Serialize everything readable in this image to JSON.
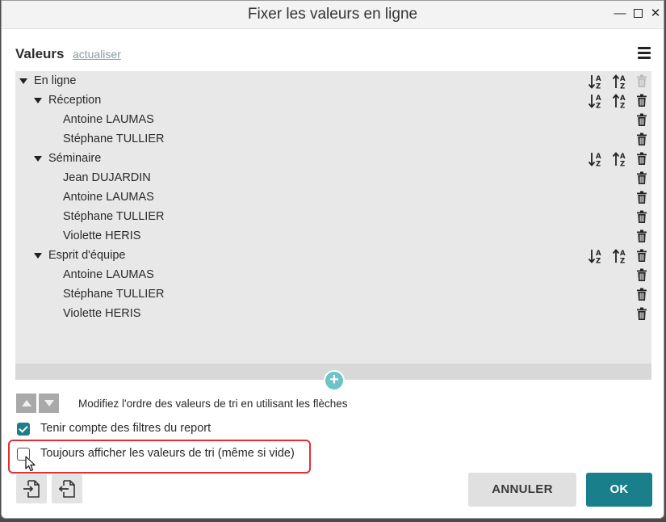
{
  "window": {
    "title": "Fixer les valeurs en ligne",
    "controls": [
      "minimize",
      "maximize",
      "close"
    ]
  },
  "header": {
    "label": "Valeurs",
    "refresh_link": "actualiser"
  },
  "tree": {
    "rows": [
      {
        "label": "En ligne",
        "level": 0,
        "expandable": true,
        "sort_buttons": true,
        "delete_enabled": false
      },
      {
        "label": "Réception",
        "level": 1,
        "expandable": true,
        "sort_buttons": true,
        "delete_enabled": true
      },
      {
        "label": "Antoine LAUMAS",
        "level": 2,
        "expandable": false,
        "sort_buttons": false,
        "delete_enabled": true
      },
      {
        "label": "Stéphane TULLIER",
        "level": 2,
        "expandable": false,
        "sort_buttons": false,
        "delete_enabled": true
      },
      {
        "label": "Séminaire",
        "level": 1,
        "expandable": true,
        "sort_buttons": true,
        "delete_enabled": true
      },
      {
        "label": "Jean DUJARDIN",
        "level": 2,
        "expandable": false,
        "sort_buttons": false,
        "delete_enabled": true
      },
      {
        "label": "Antoine LAUMAS",
        "level": 2,
        "expandable": false,
        "sort_buttons": false,
        "delete_enabled": true
      },
      {
        "label": "Stéphane TULLIER",
        "level": 2,
        "expandable": false,
        "sort_buttons": false,
        "delete_enabled": true
      },
      {
        "label": "Violette HERIS",
        "level": 2,
        "expandable": false,
        "sort_buttons": false,
        "delete_enabled": true
      },
      {
        "label": "Esprit d'équipe",
        "level": 1,
        "expandable": true,
        "sort_buttons": true,
        "delete_enabled": true
      },
      {
        "label": "Antoine LAUMAS",
        "level": 2,
        "expandable": false,
        "sort_buttons": false,
        "delete_enabled": true
      },
      {
        "label": "Stéphane TULLIER",
        "level": 2,
        "expandable": false,
        "sort_buttons": false,
        "delete_enabled": true
      },
      {
        "label": "Violette HERIS",
        "level": 2,
        "expandable": false,
        "sort_buttons": false,
        "delete_enabled": true
      }
    ]
  },
  "add_button_label": "+",
  "order": {
    "hint": "Modifiez l'ordre des valeurs de tri en utilisant les flèches"
  },
  "options": {
    "report_filters": {
      "label": "Tenir compte des filtres du report",
      "checked": true
    },
    "always_show": {
      "label": "Toujours afficher les valeurs de tri (même si vide)",
      "checked": false
    }
  },
  "buttons": {
    "cancel": "ANNULER",
    "ok": "OK"
  },
  "colors": {
    "accent": "#187f8b",
    "add_button": "#6cc3c8",
    "highlight": "#e03030"
  }
}
